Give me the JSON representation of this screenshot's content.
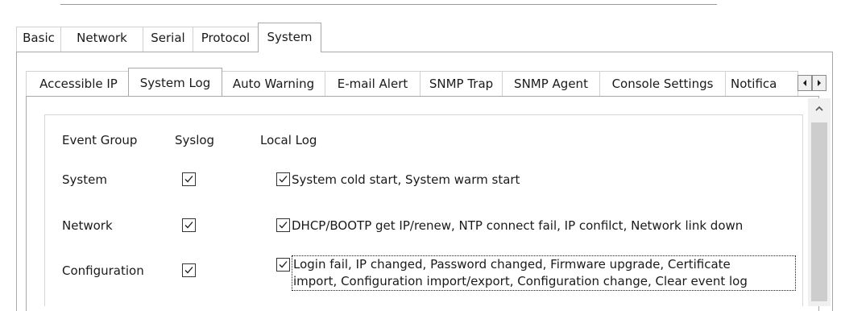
{
  "main_tabs": [
    "Basic",
    "Network",
    "Serial",
    "Protocol",
    "System"
  ],
  "main_active": "System",
  "sub_tabs": [
    "Accessible IP",
    "System Log",
    "Auto Warning",
    "E-mail Alert",
    "SNMP Trap",
    "SNMP Agent",
    "Console Settings",
    "Notifica"
  ],
  "sub_active": "System Log",
  "headers": {
    "event_group": "Event Group",
    "syslog": "Syslog",
    "local_log": "Local Log"
  },
  "rows": [
    {
      "group": "System",
      "syslog_checked": true,
      "local_checked": true,
      "events_line1": "System cold start, System warm start",
      "events_line2": ""
    },
    {
      "group": "Network",
      "syslog_checked": true,
      "local_checked": true,
      "events_line1": "DHCP/BOOTP get IP/renew, NTP connect fail, IP confilct, Network link down",
      "events_line2": ""
    },
    {
      "group": "Configuration",
      "syslog_checked": true,
      "local_checked": true,
      "events_line1": "Login fail, IP changed, Password changed, Firmware upgrade, Certificate",
      "events_line2": "import, Configuration import/export, Configuration change, Clear event log"
    }
  ],
  "icons": {
    "tab_scroll_left": "triangle-left-icon",
    "tab_scroll_right": "triangle-right-icon",
    "scroll_up": "chevron-up-icon",
    "checkbox": "checkmark-icon"
  }
}
